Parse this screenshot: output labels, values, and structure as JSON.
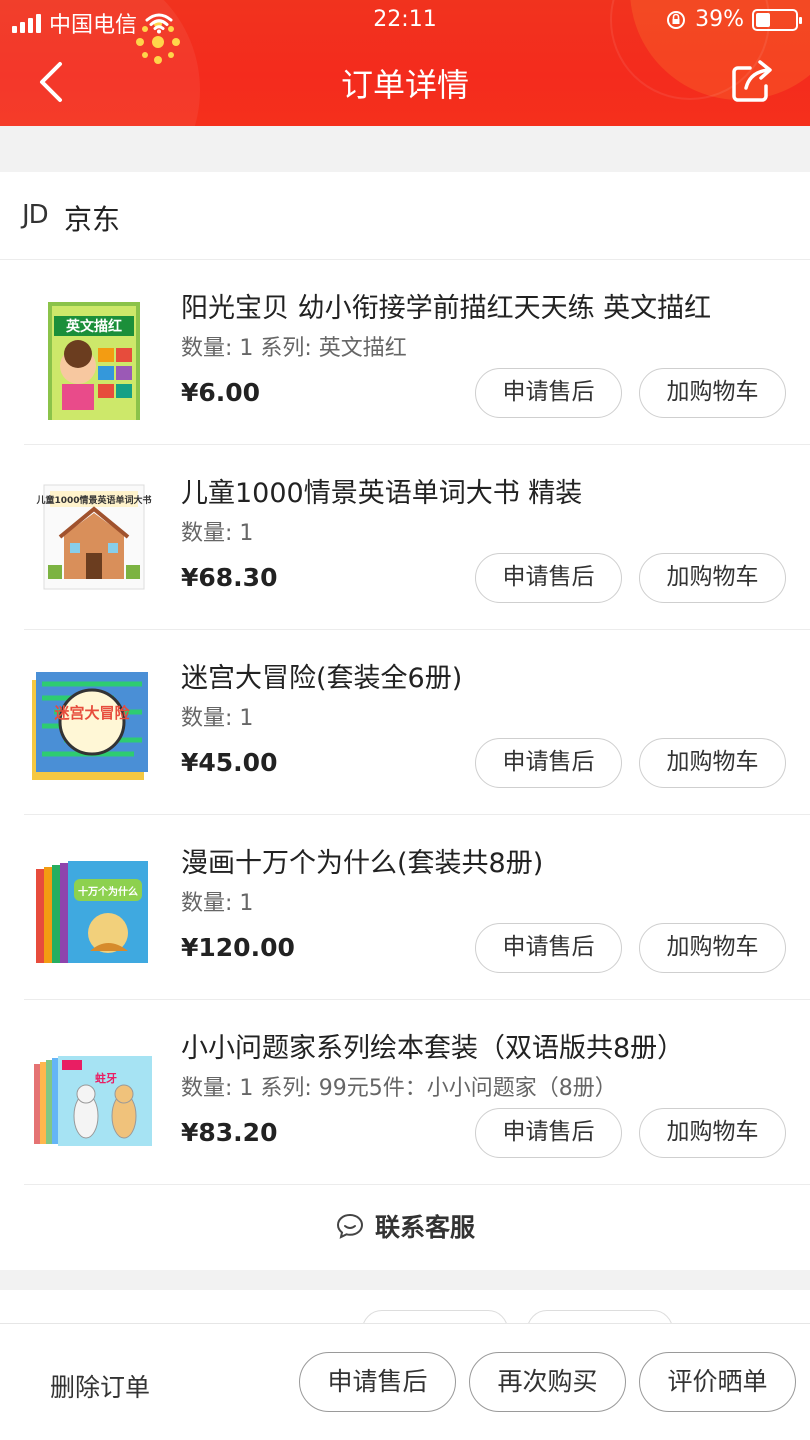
{
  "status_bar": {
    "carrier": "中国电信",
    "time": "22:11",
    "battery": "39%"
  },
  "nav": {
    "title": "订单详情"
  },
  "store": {
    "logo": "JD",
    "name": "京东"
  },
  "items": [
    {
      "name": "阳光宝贝 幼小衔接学前描红天天练 英文描红",
      "meta": "数量: 1 系列: 英文描红",
      "price": "¥6.00",
      "thumb_title": "英文描红"
    },
    {
      "name": "儿童1000情景英语单词大书 精装",
      "meta": "数量: 1",
      "price": "¥68.30",
      "thumb_title": "儿童1000情景英语单词大书"
    },
    {
      "name": "迷宫大冒险(套装全6册)",
      "meta": "数量: 1",
      "price": "¥45.00",
      "thumb_title": "迷宫大冒险"
    },
    {
      "name": "漫画十万个为什么(套装共8册)",
      "meta": "数量: 1",
      "price": "¥120.00",
      "thumb_title": "十万个为什么"
    },
    {
      "name": "小小问题家系列绘本套装（双语版共8册）",
      "meta": "数量: 1 系列: 99元5件：小小问题家（8册）",
      "price": "¥83.20",
      "thumb_title": "蛀牙"
    }
  ],
  "item_buttons": {
    "after_sales": "申请售后",
    "add_cart": "加购物车"
  },
  "service": {
    "label": "联系客服"
  },
  "bottom": {
    "delete": "删除订单",
    "after_sales": "申请售后",
    "buy_again": "再次购买",
    "review": "评价晒单"
  },
  "colors": {
    "header_red": "#f42b1d",
    "text": "#222222",
    "muted": "#666666"
  }
}
